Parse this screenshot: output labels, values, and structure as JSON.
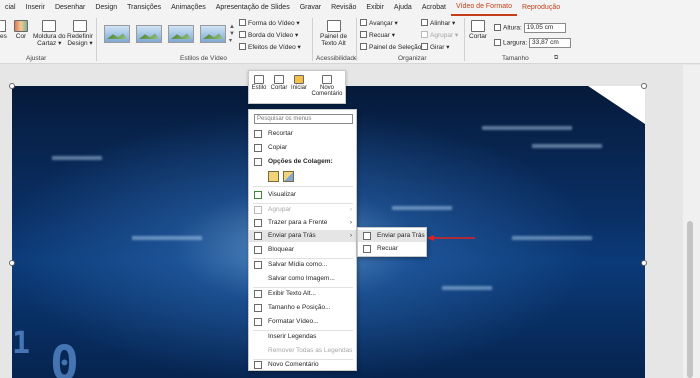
{
  "tabs": [
    {
      "label": "cial"
    },
    {
      "label": "Inserir"
    },
    {
      "label": "Desenhar"
    },
    {
      "label": "Design"
    },
    {
      "label": "Transições"
    },
    {
      "label": "Animações"
    },
    {
      "label": "Apresentação de Slides"
    },
    {
      "label": "Gravar"
    },
    {
      "label": "Revisão"
    },
    {
      "label": "Exibir"
    },
    {
      "label": "Ajuda"
    },
    {
      "label": "Acrobat"
    },
    {
      "label": "Vídeo de Formato"
    },
    {
      "label": "Reprodução"
    }
  ],
  "ribbon": {
    "ajustar": {
      "es": "es",
      "cor": "Cor",
      "moldura": "Moldura do",
      "cartaz": "Cartaz ▾",
      "redefinir": "Redefinir",
      "design": "Design ▾",
      "label": "Ajustar"
    },
    "estilos": {
      "forma": "Forma do Vídeo ▾",
      "borda": "Borda do Vídeo ▾",
      "efeitos": "Efeitos de Vídeo ▾",
      "label": "Estilos de Vídeo"
    },
    "acess": {
      "painel": "Painel de",
      "texto_alt": "Texto Alt",
      "label": "Acessibilidade"
    },
    "organizar": {
      "avancar": "Avançar ▾",
      "recuar": "Recuar ▾",
      "painel_sel": "Painel de Seleção",
      "alinhar": "Alinhar ▾",
      "agrupar": "Agrupar ▾",
      "girar": "Girar ▾",
      "label": "Organizar"
    },
    "tamanho": {
      "cortar": "Cortar",
      "altura_label": "Altura:",
      "altura": "19,05 cm",
      "largura_label": "Largura:",
      "largura": "33,87 cm",
      "label": "Tamanho"
    }
  },
  "mini_toolbar": {
    "estilo": "Estilo",
    "cortar": "Cortar",
    "iniciar": "Iniciar",
    "novo": "Novo",
    "comentario": "Comentário"
  },
  "context_menu": {
    "search_placeholder": "Pesquisar os menus",
    "recortar": "Recortar",
    "copiar": "Copiar",
    "opcoes_colagem": "Opções de Colagem:",
    "visualizar": "Visualizar",
    "agrupar": "Agrupar",
    "trazer_frente": "Trazer para a Frente",
    "enviar_tras": "Enviar para Trás",
    "bloquear": "Bloquear",
    "salvar_midia": "Salvar Mídia como...",
    "salvar_imagem": "Salvar como Imagem...",
    "exibir_texto_alt": "Exibir Texto Alt...",
    "tamanho_posicao": "Tamanho e Posição...",
    "formatar_video": "Formatar Vídeo...",
    "inserir_legendas": "Inserir Legendas",
    "remover_legendas": "Remover Todas as Legendas",
    "novo_comentario": "Novo Comentário"
  },
  "submenu": {
    "enviar_para_tras": "Enviar para Trás",
    "recuar": "Recuar"
  },
  "colors": {
    "accent": "#c43e1c",
    "arrow": "#e02020"
  }
}
